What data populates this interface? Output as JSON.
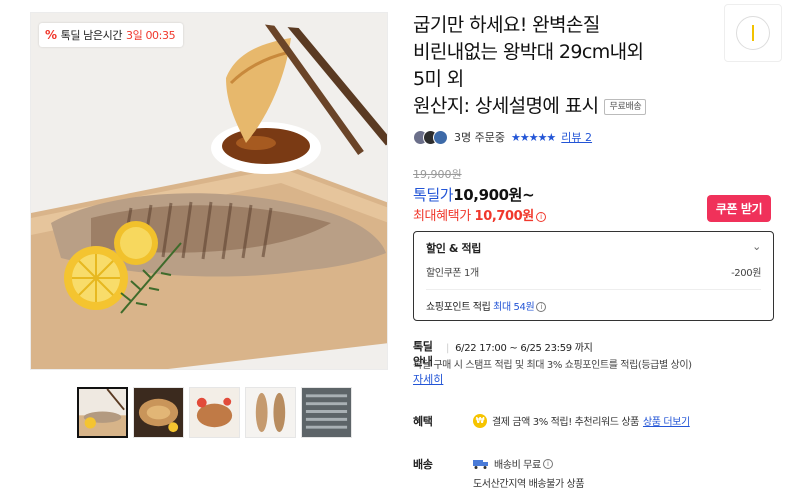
{
  "deal_badge": {
    "percent_icon": "%",
    "label": "톡딜 남은시간",
    "timer": "3일 00:35"
  },
  "title": {
    "lines": [
      "굽기만 하세요! 완벽손질",
      "비린내없는 왕박대 29cm내외",
      "5미 외",
      "원산지: 상세설명에 표시"
    ],
    "shipping_chip": "무료배송"
  },
  "review": {
    "orders": "3명 주문중",
    "stars": "★★★★★",
    "link": "리뷰 2"
  },
  "price": {
    "original": "19,900원",
    "deal_label": "톡딜가",
    "deal_value": "10,900원~",
    "max_label": "최대혜택가",
    "max_value": "10,700원"
  },
  "coupon_button": "쿠폰 받기",
  "discount": {
    "title": "할인 & 적립",
    "coupon_label": "할인쿠폰 1개",
    "coupon_value": "-200원",
    "points_label": "쇼핑포인트 적립",
    "points_value": "최대 54원"
  },
  "deal_info": {
    "label": "톡딜 안내",
    "period": "6/22 17:00 ~ 6/25 23:59 까지",
    "desc": "톡딜 구매 시 스탬프 적립 및 최대 3% 쇼핑포인트를 적립(등급별 상이)",
    "more": "자세히"
  },
  "benefit": {
    "label": "혜택",
    "icon_text": "₩",
    "text": "결제 금액 3% 적립! 추천리워드 상품",
    "link": "상품 더보기"
  },
  "shipping": {
    "label": "배송",
    "fee": "배송비 무료",
    "note": "도서산간지역 배송불가 상품"
  },
  "icons": [
    "percent-icon",
    "info-icon",
    "chevron-down-icon",
    "won-coin-icon",
    "truck-icon"
  ],
  "colors": {
    "accent_red": "#f0382c",
    "accent_blue": "#2355d6",
    "coupon_pink": "#f0315a"
  }
}
